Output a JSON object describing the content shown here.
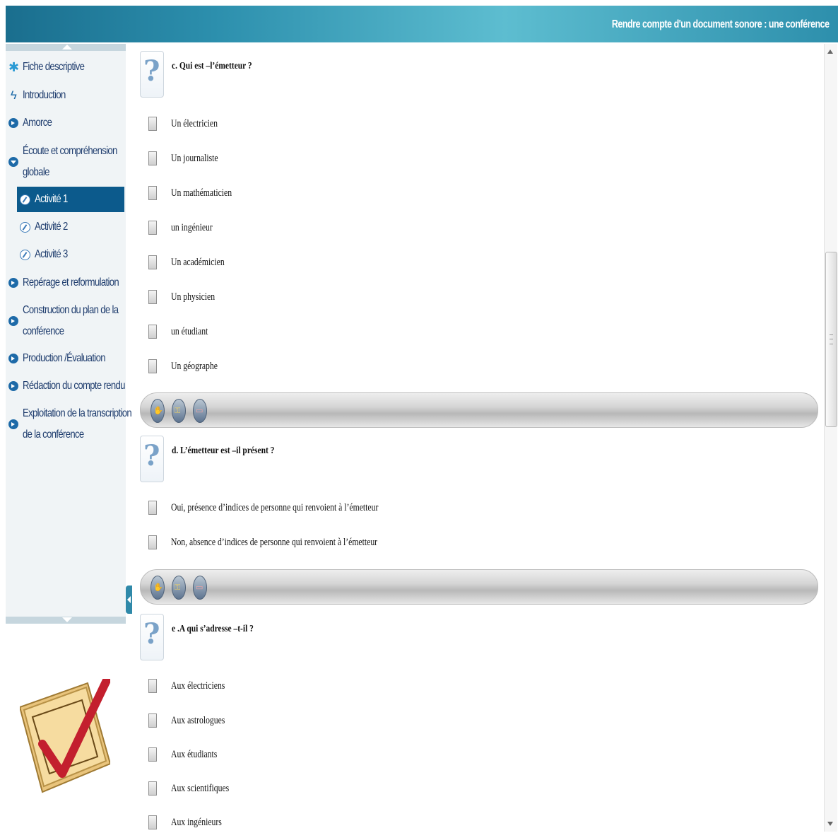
{
  "header": {
    "title": "Rendre compte d'un document sonore : une conférence"
  },
  "sidebar": {
    "items": [
      {
        "label": "Fiche descriptive",
        "icon": "star-icon"
      },
      {
        "label": "Introduction",
        "icon": "bolt-icon"
      },
      {
        "label": "Amorce",
        "icon": "chevron-right-icon"
      },
      {
        "label": "Écoute et compréhension",
        "label2": "globale",
        "icon": "chevron-down-icon"
      },
      {
        "label": "Activité 1",
        "icon": "activity-icon",
        "active": true
      },
      {
        "label": "Activité 2",
        "icon": "activity-icon"
      },
      {
        "label": "Activité 3",
        "icon": "activity-icon"
      },
      {
        "label": "Repérage et reformulation",
        "icon": "chevron-right-icon"
      },
      {
        "label": "Construction du plan de la",
        "label2": "conférence",
        "icon": "chevron-right-icon"
      },
      {
        "label": "Production /Évaluation",
        "icon": "chevron-right-icon"
      },
      {
        "label": "Rédaction du compte rendu",
        "icon": "chevron-right-icon"
      },
      {
        "label": "Exploitation de la transcription",
        "label2": "de la conférence",
        "icon": "chevron-right-icon"
      }
    ]
  },
  "questions": [
    {
      "title": "c. Qui est –l’émetteur ?",
      "options": [
        "Un électricien",
        "Un journaliste",
        "Un mathématicien",
        "un ingénieur",
        "Un académicien",
        "Un physicien",
        "un étudiant",
        "Un géographe"
      ]
    },
    {
      "title": "d. L’émetteur est –il présent ?",
      "options": [
        "Oui, présence d’indices de personne qui renvoient à l’émetteur",
        "Non, absence d’indices de personne qui renvoient à l’émetteur"
      ]
    },
    {
      "title": "e .A qui s’adresse –t-il ?",
      "options": [
        "Aux électriciens",
        "Aux astrologues",
        "Aux étudiants",
        "Aux scientifiques",
        "Aux ingénieurs"
      ]
    }
  ],
  "question_icon": "?",
  "colors": {
    "header": "#2c8fad",
    "nav_text": "#1f3d6e",
    "nav_active": "#0c5a8c"
  }
}
